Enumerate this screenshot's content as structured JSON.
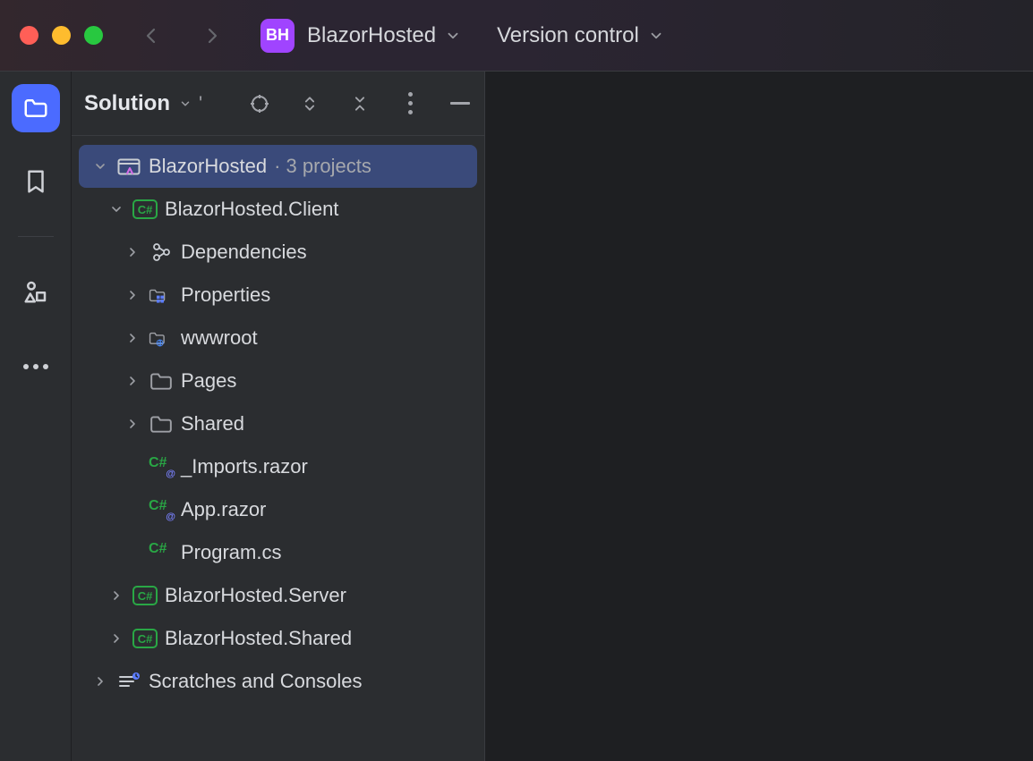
{
  "titlebar": {
    "project_initials": "BH",
    "project_name": "BlazorHosted",
    "vcs_label": "Version control"
  },
  "panel": {
    "title": "Solution"
  },
  "tree": {
    "root": {
      "name": "BlazorHosted",
      "suffix": " · 3 projects"
    },
    "client": {
      "name": "BlazorHosted.Client",
      "deps": "Dependencies",
      "props": "Properties",
      "wwwroot": "wwwroot",
      "pages": "Pages",
      "shared": "Shared",
      "imports": "_Imports.razor",
      "app": "App.razor",
      "program": "Program.cs"
    },
    "server": {
      "name": "BlazorHosted.Server"
    },
    "shared": {
      "name": "BlazorHosted.Shared"
    },
    "scratches": "Scratches and Consoles"
  },
  "icons": {
    "cs": "C#"
  }
}
